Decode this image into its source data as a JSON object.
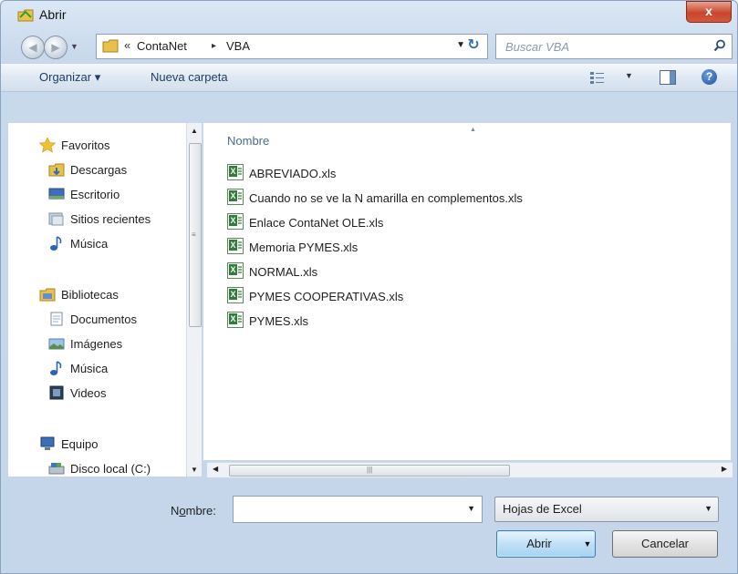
{
  "window": {
    "title": "Abrir",
    "close_label": "x"
  },
  "address": {
    "segments": [
      "ContaNet",
      "VBA"
    ],
    "prefix_glyph": "«",
    "separator_glyph": "▸",
    "search_placeholder": "Buscar VBA"
  },
  "toolbar": {
    "organize": "Organizar ▾",
    "new_folder": "Nueva carpeta",
    "help": "?"
  },
  "nav": {
    "items": [
      {
        "label": "Favoritos",
        "icon": "star-icon",
        "group": true
      },
      {
        "label": "Descargas",
        "icon": "downloads-folder-icon"
      },
      {
        "label": "Escritorio",
        "icon": "desktop-icon"
      },
      {
        "label": "Sitios recientes",
        "icon": "recent-places-icon"
      },
      {
        "label": "Música",
        "icon": "music-icon"
      },
      {
        "label": "Bibliotecas",
        "icon": "libraries-icon",
        "group": true
      },
      {
        "label": "Documentos",
        "icon": "documents-icon"
      },
      {
        "label": "Imágenes",
        "icon": "pictures-icon"
      },
      {
        "label": "Música",
        "icon": "music-icon"
      },
      {
        "label": "Videos",
        "icon": "videos-icon"
      },
      {
        "label": "Equipo",
        "icon": "computer-icon",
        "group": true
      },
      {
        "label": "Disco local (C:)",
        "icon": "local-disk-icon"
      }
    ]
  },
  "files": {
    "column_header": "Nombre",
    "items": [
      "ABREVIADO.xls",
      "Cuando no se ve la N amarilla en complementos.xls",
      "Enlace ContaNet OLE.xls",
      "Memoria PYMES.xls",
      "NORMAL.xls",
      "PYMES COOPERATIVAS.xls",
      "PYMES.xls"
    ]
  },
  "bottom": {
    "name_label_pre": "N",
    "name_label_accel": "o",
    "name_label_post": "mbre:",
    "name_value": "",
    "filter_value": "Hojas de Excel",
    "open_label": "Abrir",
    "cancel_label": "Cancelar"
  },
  "colors": {
    "accent": "#2c6fb6",
    "close_red": "#c9452c",
    "xls_green": "#2f7d3a"
  }
}
